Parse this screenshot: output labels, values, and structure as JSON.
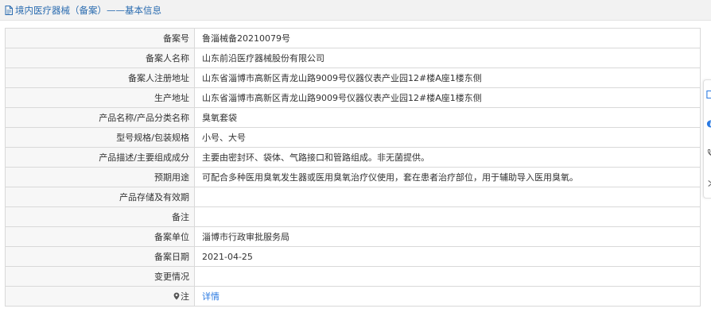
{
  "header": {
    "title": "境内医疗器械（备案）——基本信息",
    "icon": "document-icon",
    "accent_color": "#2b6cb0"
  },
  "rows": [
    {
      "label": "备案号",
      "value": "鲁淄械备20210079号"
    },
    {
      "label": "备案人名称",
      "value": "山东前沿医疗器械股份有限公司"
    },
    {
      "label": "备案人注册地址",
      "value": "山东省淄博市高新区青龙山路9009号仪器仪表产业园12#楼A座1楼东侧"
    },
    {
      "label": "生产地址",
      "value": "山东省淄博市高新区青龙山路9009号仪器仪表产业园12#楼A座1楼东侧"
    },
    {
      "label": "产品名称/产品分类名称",
      "value": "臭氧套袋"
    },
    {
      "label": "型号规格/包装规格",
      "value": "小号、大号"
    },
    {
      "label": "产品描述/主要组成成分",
      "value": "主要由密封环、袋体、气路接口和管路组成。非无菌提供。"
    },
    {
      "label": "预期用途",
      "value": "可配合多种医用臭氧发生器或医用臭氧治疗仪使用，套在患者治疗部位，用于辅助导入医用臭氧。"
    },
    {
      "label": "产品存储及有效期",
      "value": ""
    },
    {
      "label": "备注",
      "value": ""
    },
    {
      "label": "备案单位",
      "value": "淄博市行政审批服务局"
    },
    {
      "label": "备案日期",
      "value": "2021-04-25"
    },
    {
      "label": "变更情况",
      "value": ""
    }
  ],
  "note_row": {
    "label": "注",
    "icon": "map-pin-icon",
    "link_text": "详情",
    "link_color": "#2a7ae2"
  },
  "side_toolbar": {
    "icons": [
      "document-icon",
      "info-circle-icon",
      "phone-icon",
      "collapse-arrow-icon"
    ]
  }
}
